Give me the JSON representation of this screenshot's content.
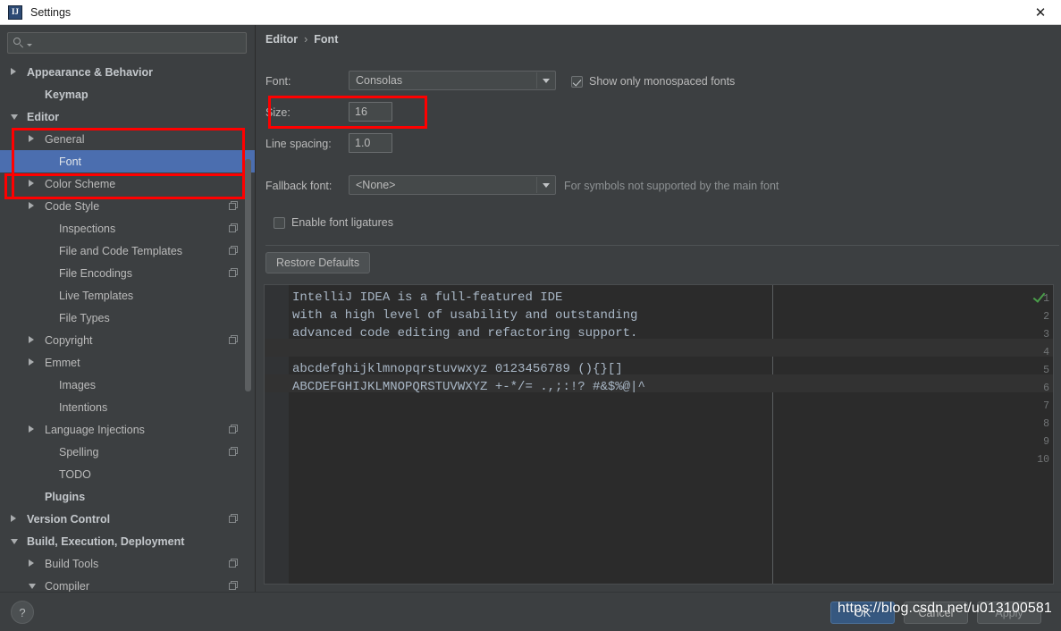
{
  "window": {
    "title": "Settings",
    "app_icon": "IJ",
    "close_icon": "✕"
  },
  "search": {
    "placeholder": "",
    "value": "",
    "icon": "search-icon"
  },
  "sidebar": {
    "items": [
      {
        "label": "Appearance & Behavior",
        "indent": 0,
        "arrow": "right",
        "bold": true,
        "copy": false,
        "selected": false
      },
      {
        "label": "Keymap",
        "indent": 1,
        "arrow": "none",
        "bold": true,
        "copy": false,
        "selected": false
      },
      {
        "label": "Editor",
        "indent": 0,
        "arrow": "down",
        "bold": true,
        "copy": false,
        "selected": false
      },
      {
        "label": "General",
        "indent": 1,
        "arrow": "right",
        "bold": false,
        "copy": false,
        "selected": false
      },
      {
        "label": "Font",
        "indent": 2,
        "arrow": "none",
        "bold": false,
        "copy": false,
        "selected": true
      },
      {
        "label": "Color Scheme",
        "indent": 1,
        "arrow": "right",
        "bold": false,
        "copy": false,
        "selected": false
      },
      {
        "label": "Code Style",
        "indent": 1,
        "arrow": "right",
        "bold": false,
        "copy": true,
        "selected": false
      },
      {
        "label": "Inspections",
        "indent": 2,
        "arrow": "none",
        "bold": false,
        "copy": true,
        "selected": false
      },
      {
        "label": "File and Code Templates",
        "indent": 2,
        "arrow": "none",
        "bold": false,
        "copy": true,
        "selected": false
      },
      {
        "label": "File Encodings",
        "indent": 2,
        "arrow": "none",
        "bold": false,
        "copy": true,
        "selected": false
      },
      {
        "label": "Live Templates",
        "indent": 2,
        "arrow": "none",
        "bold": false,
        "copy": false,
        "selected": false
      },
      {
        "label": "File Types",
        "indent": 2,
        "arrow": "none",
        "bold": false,
        "copy": false,
        "selected": false
      },
      {
        "label": "Copyright",
        "indent": 1,
        "arrow": "right",
        "bold": false,
        "copy": true,
        "selected": false
      },
      {
        "label": "Emmet",
        "indent": 1,
        "arrow": "right",
        "bold": false,
        "copy": false,
        "selected": false
      },
      {
        "label": "Images",
        "indent": 2,
        "arrow": "none",
        "bold": false,
        "copy": false,
        "selected": false
      },
      {
        "label": "Intentions",
        "indent": 2,
        "arrow": "none",
        "bold": false,
        "copy": false,
        "selected": false
      },
      {
        "label": "Language Injections",
        "indent": 1,
        "arrow": "right",
        "bold": false,
        "copy": true,
        "selected": false
      },
      {
        "label": "Spelling",
        "indent": 2,
        "arrow": "none",
        "bold": false,
        "copy": true,
        "selected": false
      },
      {
        "label": "TODO",
        "indent": 2,
        "arrow": "none",
        "bold": false,
        "copy": false,
        "selected": false
      },
      {
        "label": "Plugins",
        "indent": 1,
        "arrow": "none",
        "bold": true,
        "copy": false,
        "selected": false
      },
      {
        "label": "Version Control",
        "indent": 0,
        "arrow": "right",
        "bold": true,
        "copy": true,
        "selected": false
      },
      {
        "label": "Build, Execution, Deployment",
        "indent": 0,
        "arrow": "down",
        "bold": true,
        "copy": false,
        "selected": false
      },
      {
        "label": "Build Tools",
        "indent": 1,
        "arrow": "right",
        "bold": false,
        "copy": true,
        "selected": false
      },
      {
        "label": "Compiler",
        "indent": 1,
        "arrow": "down",
        "bold": false,
        "copy": true,
        "selected": false
      }
    ]
  },
  "breadcrumb": {
    "parent": "Editor",
    "separator": "›",
    "current": "Font"
  },
  "form": {
    "font_label": "Font:",
    "font_value": "Consolas",
    "monospaced_label": "Show only monospaced fonts",
    "monospaced_checked": true,
    "size_label": "Size:",
    "size_value": "16",
    "line_spacing_label": "Line spacing:",
    "line_spacing_value": "1.0",
    "fallback_label": "Fallback font:",
    "fallback_value": "<None>",
    "fallback_hint": "For symbols not supported by the main font",
    "ligatures_label": "Enable font ligatures",
    "ligatures_checked": false,
    "restore_defaults_label": "Restore Defaults"
  },
  "preview": {
    "lines": [
      {
        "num": "1",
        "text": "IntelliJ IDEA is a full-featured IDE"
      },
      {
        "num": "2",
        "text": "with a high level of usability and outstanding"
      },
      {
        "num": "3",
        "text": "advanced code editing and refactoring support."
      },
      {
        "num": "4",
        "text": ""
      },
      {
        "num": "5",
        "text": "abcdefghijklmnopqrstuvwxyz 0123456789 (){}[]"
      },
      {
        "num": "6",
        "text": "ABCDEFGHIJKLMNOPQRSTUVWXYZ +-*/= .,;:!? #&$%@|^"
      },
      {
        "num": "7",
        "text": ""
      },
      {
        "num": "8",
        "text": ""
      },
      {
        "num": "9",
        "text": ""
      },
      {
        "num": "10",
        "text": ""
      }
    ],
    "status_icon": "green-check-icon"
  },
  "footer": {
    "help_label": "?",
    "ok_label": "OK",
    "cancel_label": "Cancel",
    "apply_label": "Apply",
    "watermark": "https://blog.csdn.net/u013100581"
  },
  "colors": {
    "accent_selection": "#4b6eaf",
    "annotation_red": "#ff0000",
    "panel_bg": "#3c3f41",
    "editor_bg": "#2b2b2b",
    "code_fg": "#a9b7c6",
    "ok_button": "#365880",
    "status_green": "#4a9d4a"
  }
}
